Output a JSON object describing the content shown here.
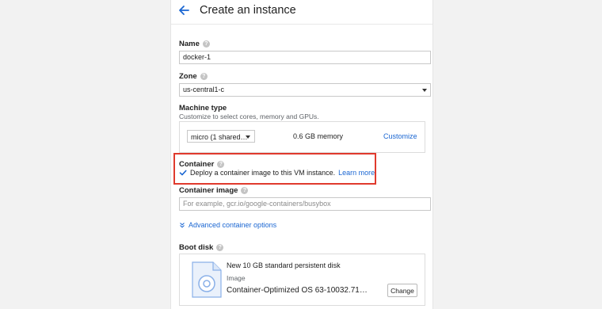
{
  "header": {
    "title": "Create an instance",
    "back_icon": "arrow-back-icon"
  },
  "name": {
    "label": "Name",
    "value": "docker-1"
  },
  "zone": {
    "label": "Zone",
    "value": "us-central1-c"
  },
  "machine_type": {
    "label": "Machine type",
    "description": "Customize to select cores, memory and GPUs.",
    "selected": "micro (1 shared…",
    "memory": "0.6 GB memory",
    "customize_link": "Customize"
  },
  "container": {
    "label": "Container",
    "checkbox_text": "Deploy a container image to this VM instance.",
    "learn_more": "Learn more",
    "checked": true
  },
  "container_image": {
    "label": "Container image",
    "placeholder": "For example, gcr.io/google-containers/busybox",
    "value": ""
  },
  "advanced_link": "Advanced container options",
  "boot_disk": {
    "label": "Boot disk",
    "title": "New 10 GB standard persistent disk",
    "kind": "Image",
    "image": "Container-Optimized OS 63-10032.71…",
    "change_button": "Change"
  },
  "colors": {
    "accent": "#1a66d2",
    "highlight": "#e03a2d",
    "background": "#f2f2f2"
  }
}
